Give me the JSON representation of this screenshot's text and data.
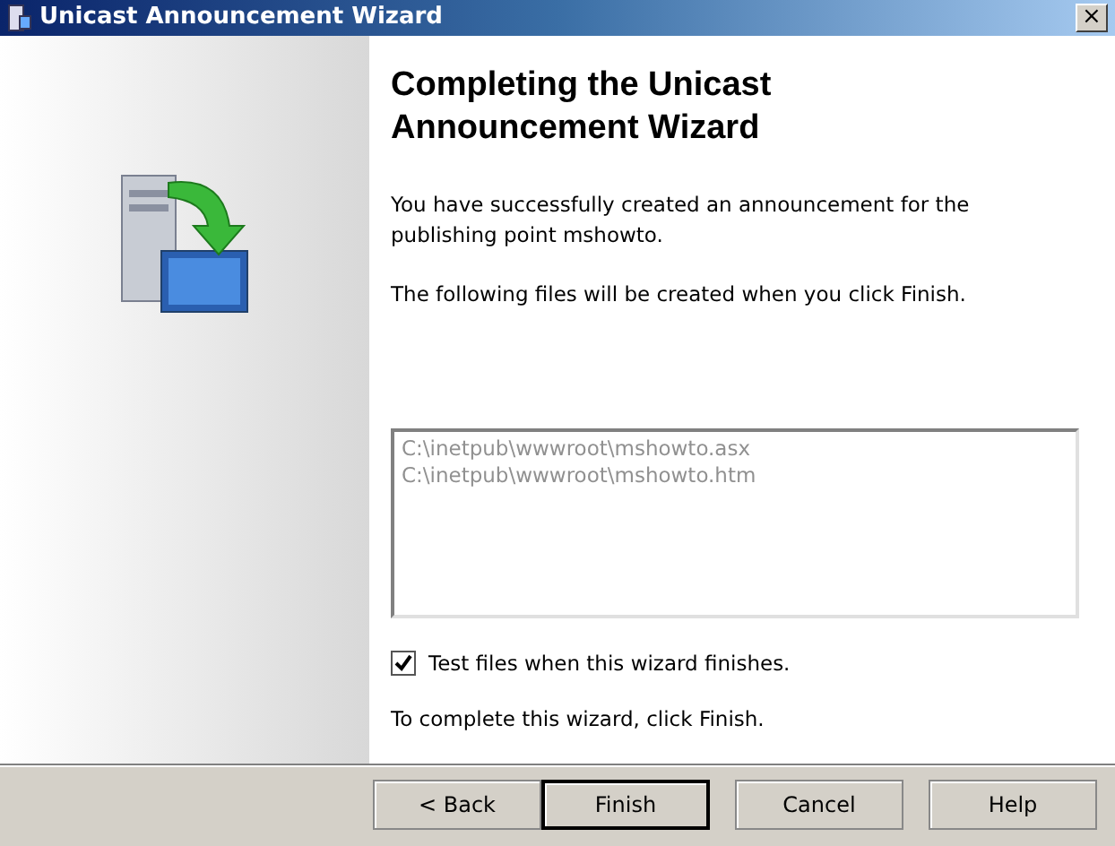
{
  "window": {
    "title": "Unicast Announcement Wizard",
    "close": "×"
  },
  "heading": "Completing the Unicast Announcement Wizard",
  "intro": "You have successfully created an announcement for the publishing point mshowto.",
  "files_intro": "The following files will be created when you click Finish.",
  "files": [
    "C:\\inetpub\\wwwroot\\mshowto.asx",
    "C:\\inetpub\\wwwroot\\mshowto.htm"
  ],
  "test_option": {
    "label": "Test files when this wizard finishes.",
    "checked": true
  },
  "footer": "To complete this wizard, click Finish.",
  "buttons": [
    {
      "label": "< Back",
      "default": false
    },
    {
      "label": "Finish",
      "default": true
    },
    {
      "label": "Cancel",
      "default": false
    },
    {
      "label": "Help",
      "default": false
    }
  ]
}
